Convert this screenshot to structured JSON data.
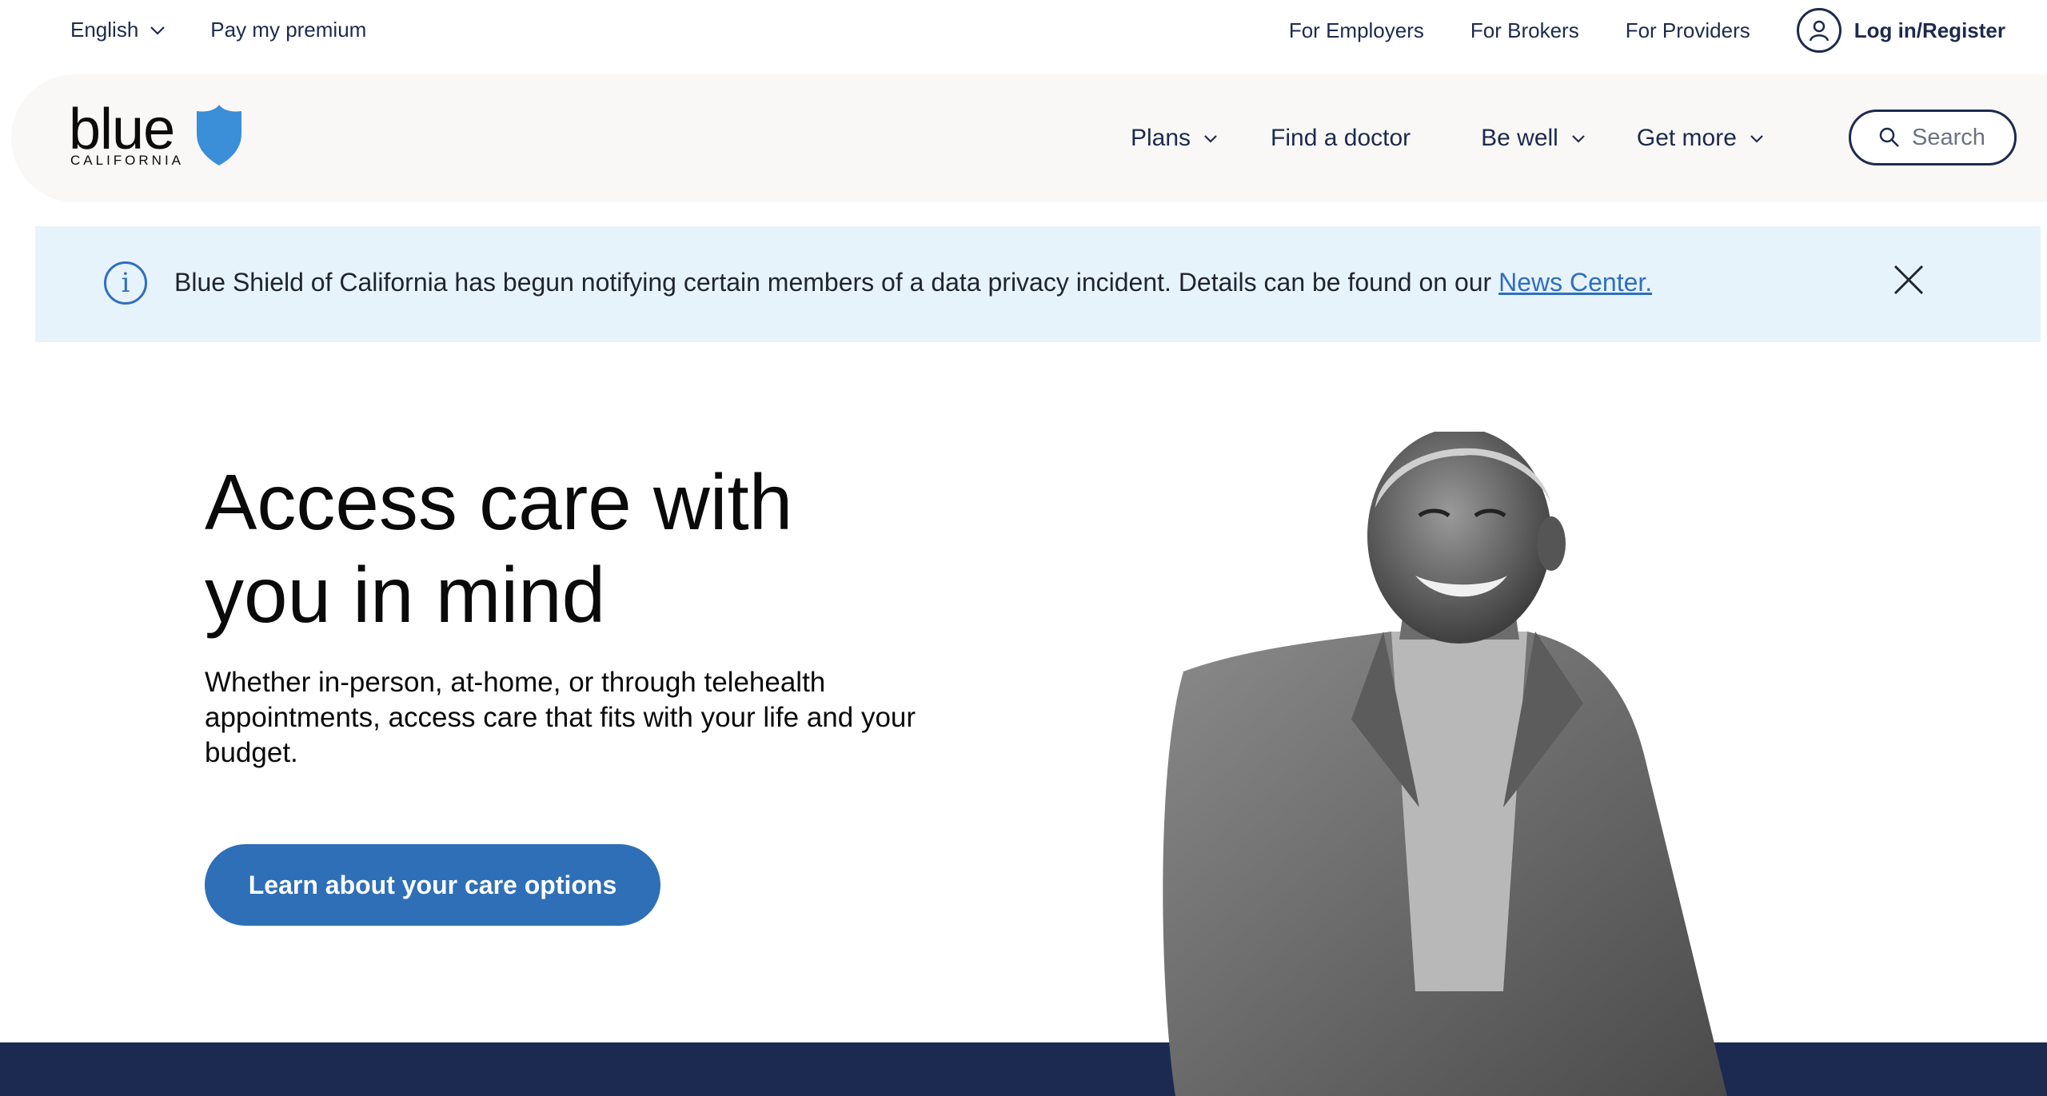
{
  "utility_bar": {
    "language": "English",
    "pay_premium": "Pay my premium",
    "links": [
      "For Employers",
      "For Brokers",
      "For Providers"
    ],
    "login": "Log in/Register"
  },
  "logo": {
    "word": "blue",
    "sub": "CALIFORNIA"
  },
  "main_nav": {
    "items": [
      "Plans",
      "Find a doctor",
      "Be well",
      "Get more"
    ],
    "search_placeholder": "Search"
  },
  "alert": {
    "message": "Blue Shield of California has begun notifying certain members of a data privacy incident. Details can be found on our ",
    "link": "News Center."
  },
  "hero": {
    "title_line1": "Access care with",
    "title_line2": "you in mind",
    "subtitle": "Whether in-person, at-home, or through telehealth appointments, access care that fits with your life and your budget.",
    "cta": "Learn about your care options"
  },
  "colors": {
    "navy": "#1d2a4d",
    "brand_blue": "#2e6fb7",
    "alert_bg": "#e7f3fa",
    "footer_band": "#1c2a52"
  }
}
